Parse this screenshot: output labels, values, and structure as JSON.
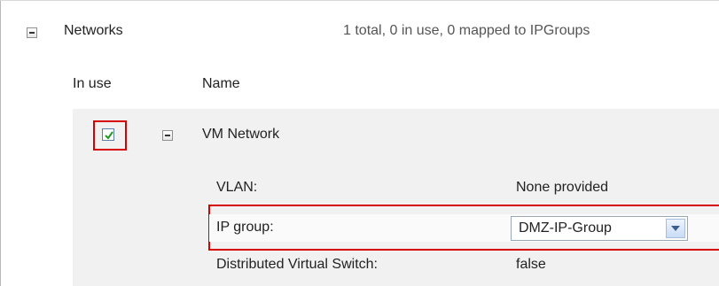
{
  "networks": {
    "title": "Networks",
    "summary": "1 total, 0 in use, 0 mapped to IPGroups",
    "columns": {
      "in_use": "In use",
      "name": "Name"
    },
    "items": [
      {
        "name": "VM Network",
        "in_use_checked": true,
        "details": {
          "vlan_label": "VLAN:",
          "vlan_value": "None provided",
          "ip_group_label": "IP group:",
          "ip_group_value": "DMZ-IP-Group",
          "dvs_label": "Distributed Virtual Switch:",
          "dvs_value": "false"
        }
      }
    ]
  },
  "colors": {
    "highlight": "#d60000",
    "checkmark": "#1f9a1f"
  },
  "icons": {
    "collapse": "collapse-icon",
    "check": "checkmark-icon",
    "dropdown": "chevron-down-icon"
  }
}
